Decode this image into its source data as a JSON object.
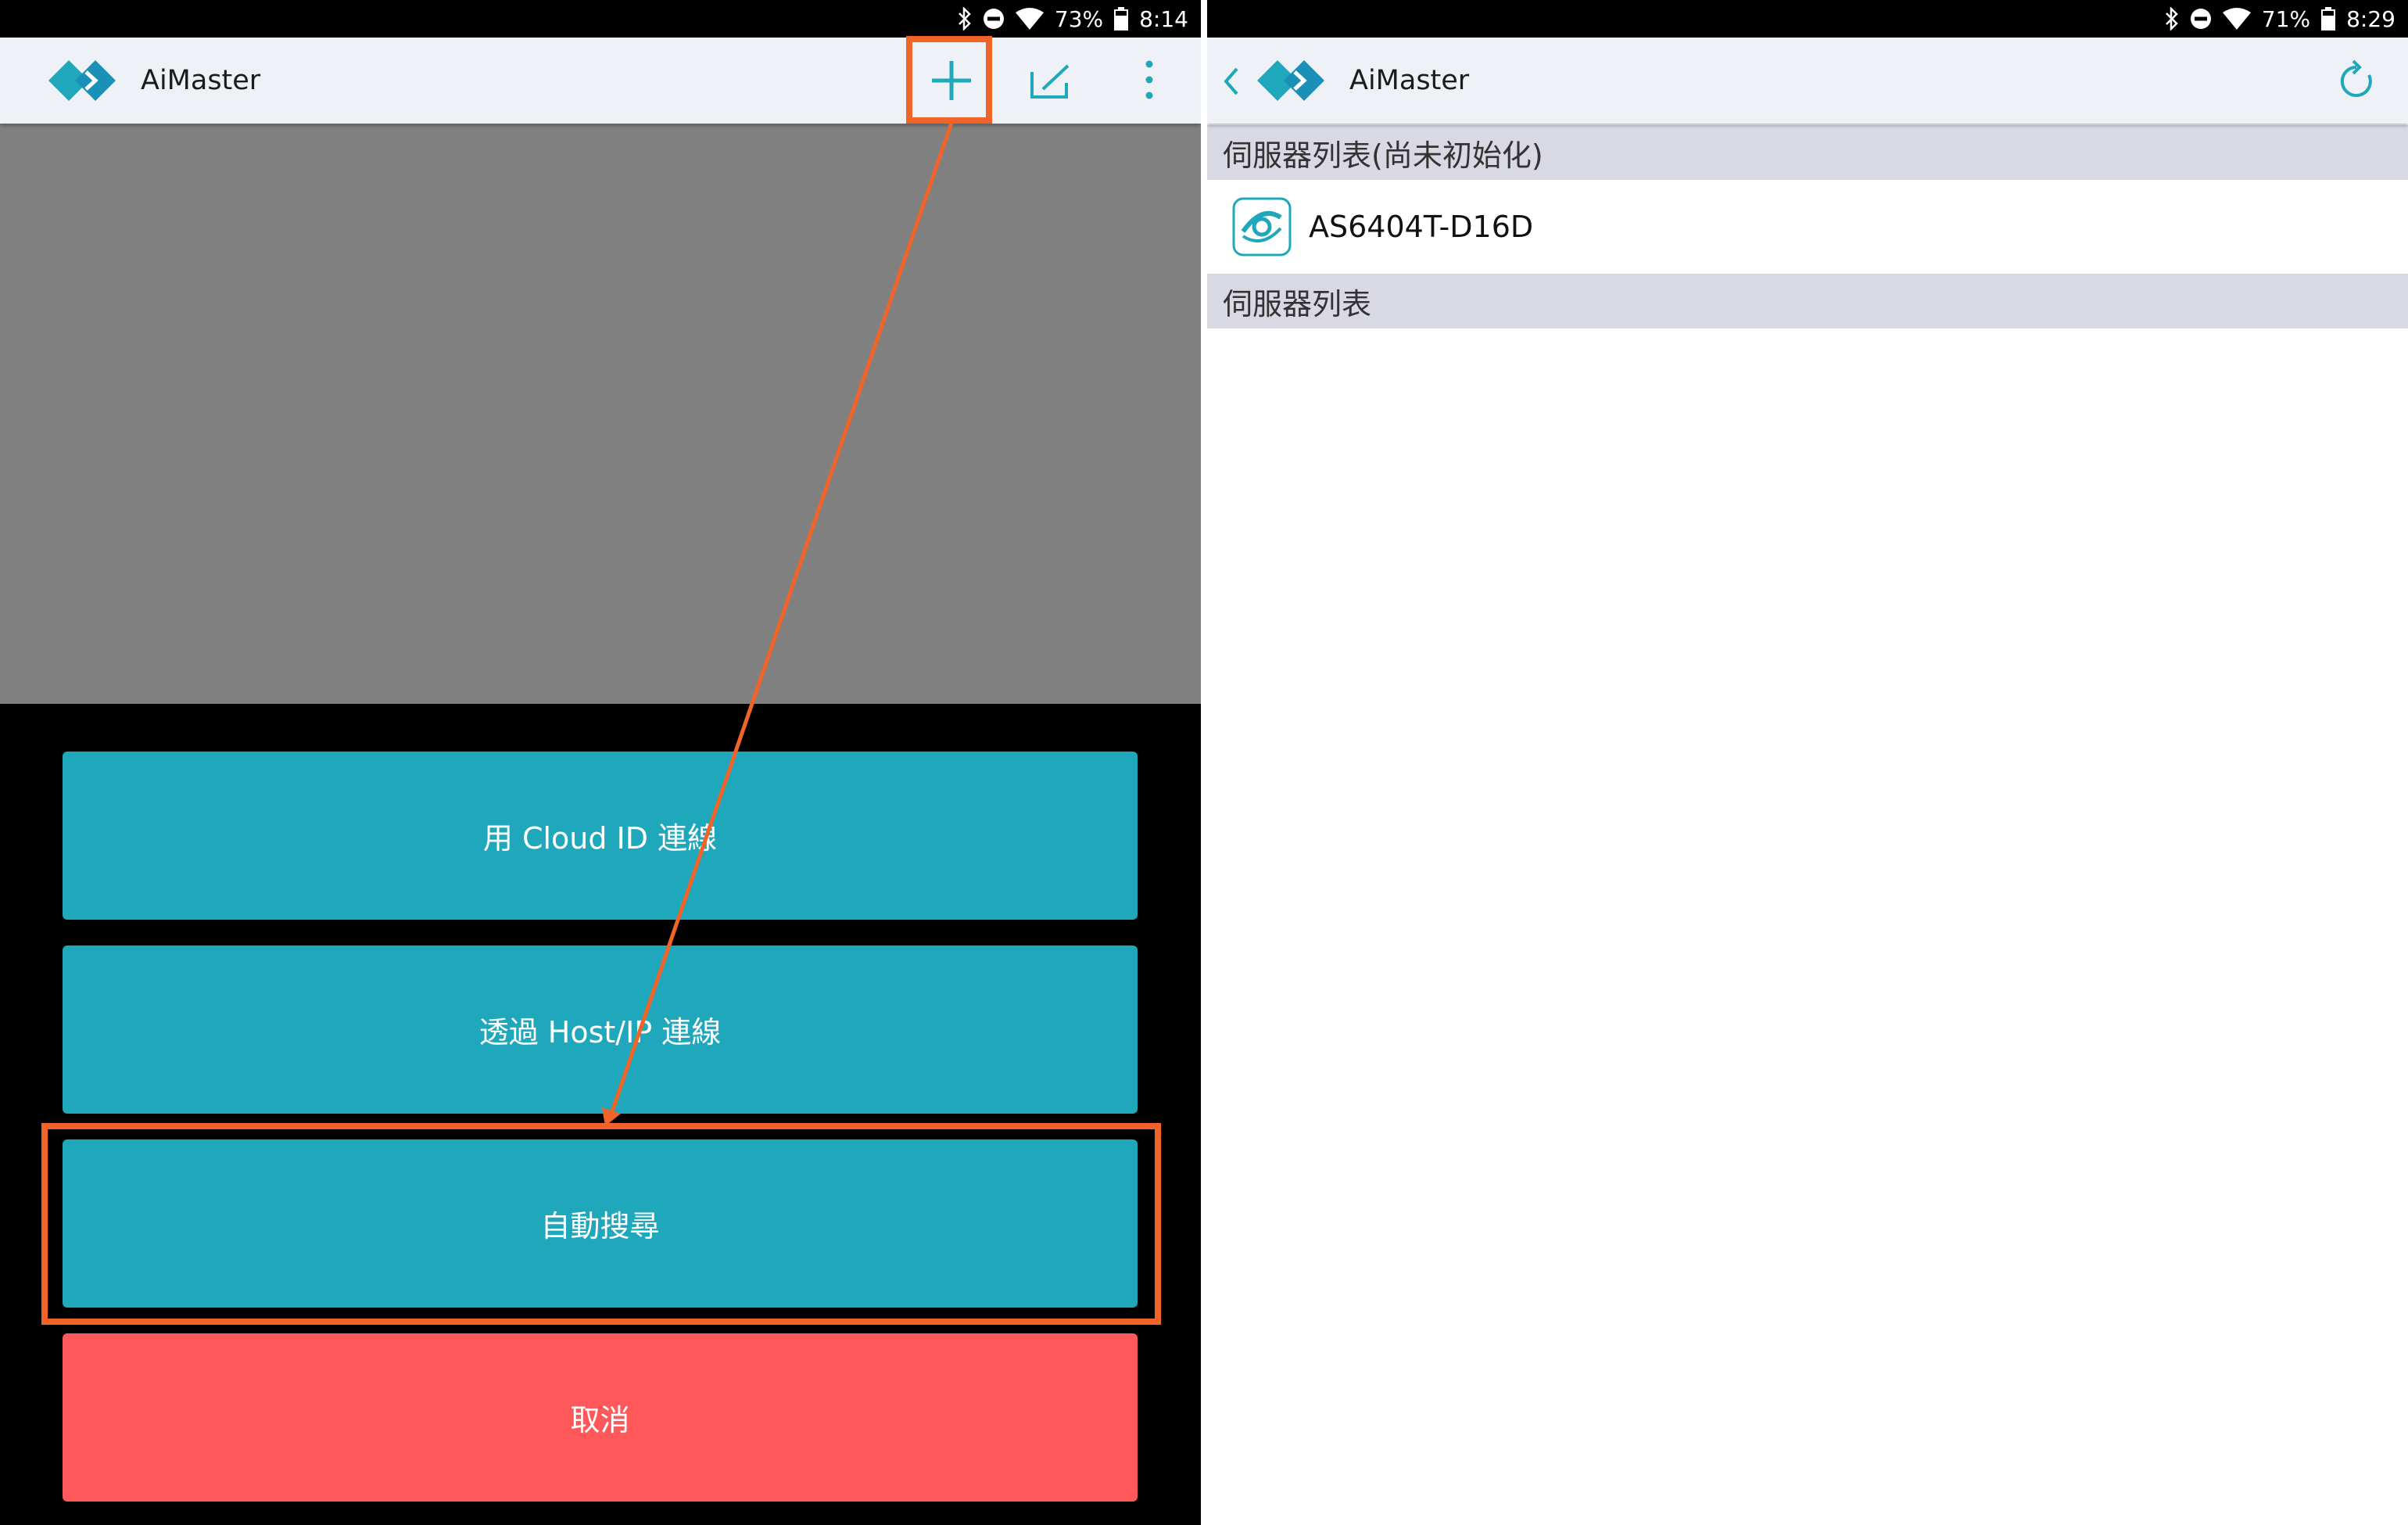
{
  "left_screen": {
    "status": {
      "battery": "73%",
      "time": "8:14"
    },
    "appbar": {
      "title": "AiMaster",
      "icons": [
        "plus-icon",
        "edit-icon",
        "more-vertical-icon"
      ]
    },
    "menu": {
      "cloud_id": "用 Cloud ID 連線",
      "host_ip": "透過 Host/IP 連線",
      "auto_search": "自動搜尋",
      "cancel": "取消"
    }
  },
  "right_screen": {
    "status": {
      "battery": "71%",
      "time": "8:29"
    },
    "appbar": {
      "title": "AiMaster",
      "icons": [
        "back-chevron-icon",
        "refresh-icon"
      ]
    },
    "sections": {
      "uninitialized": "伺服器列表(尚未初始化)",
      "servers": "伺服器列表"
    },
    "uninitialized_servers": [
      {
        "name": "AS6404T-D16D",
        "icon": "asustor-app-icon"
      }
    ]
  },
  "colors": {
    "accent_teal": "#1fa7bb",
    "cancel_red": "#ff585a",
    "annotation_orange": "#f0642a",
    "appbar_bg": "#eef1f5",
    "section_header_bg": "#d8d9e3"
  }
}
